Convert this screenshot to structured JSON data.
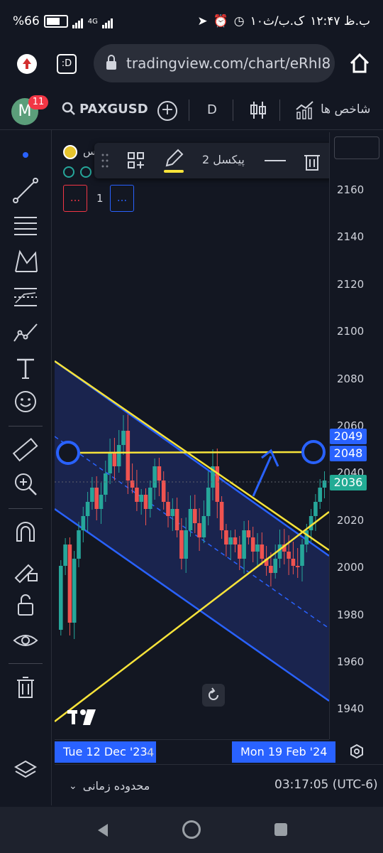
{
  "status_bar": {
    "battery": "%66",
    "network": "4G",
    "time": "۱۲:۴۷ ب.ظ",
    "carrier": "۱۰ک.ب/ث"
  },
  "browser": {
    "url": "tradingview.com/chart/eRhI8",
    "tab_count": ":D"
  },
  "header": {
    "avatar_letter": "M",
    "notification_count": "11",
    "symbol": "PAXGUSD",
    "interval": "D",
    "indicators_label": "شاخص ها"
  },
  "drawing_toolbar": {
    "width_label": "پیکسل 2",
    "accent_color": "#f7e33a"
  },
  "legend": {
    "symbol_partial": "س",
    "count": "1",
    "dots_left": "...",
    "dots_right": "..."
  },
  "price_axis": {
    "ticks": [
      "2160",
      "2140",
      "2120",
      "2100",
      "2080",
      "2060",
      "2040",
      "2020",
      "2000",
      "1980",
      "1960",
      "1940"
    ],
    "tag_upper": "2049",
    "tag_mid": "2048",
    "tag_last": "2036"
  },
  "time_axis": {
    "start_label": "Tue 12 Dec '23",
    "partial_label": "4",
    "end_label": "Mon 19 Feb '24"
  },
  "bottom_bar": {
    "range_label": "محدوده زمانی",
    "clock": "03:17:05 (UTC-6)"
  },
  "colors": {
    "background": "#131722",
    "up": "#26a69a",
    "down": "#ef5350",
    "channel_blue": "#2962ff",
    "trend_yellow": "#f7e33a",
    "last_price": "#22ab94"
  }
}
